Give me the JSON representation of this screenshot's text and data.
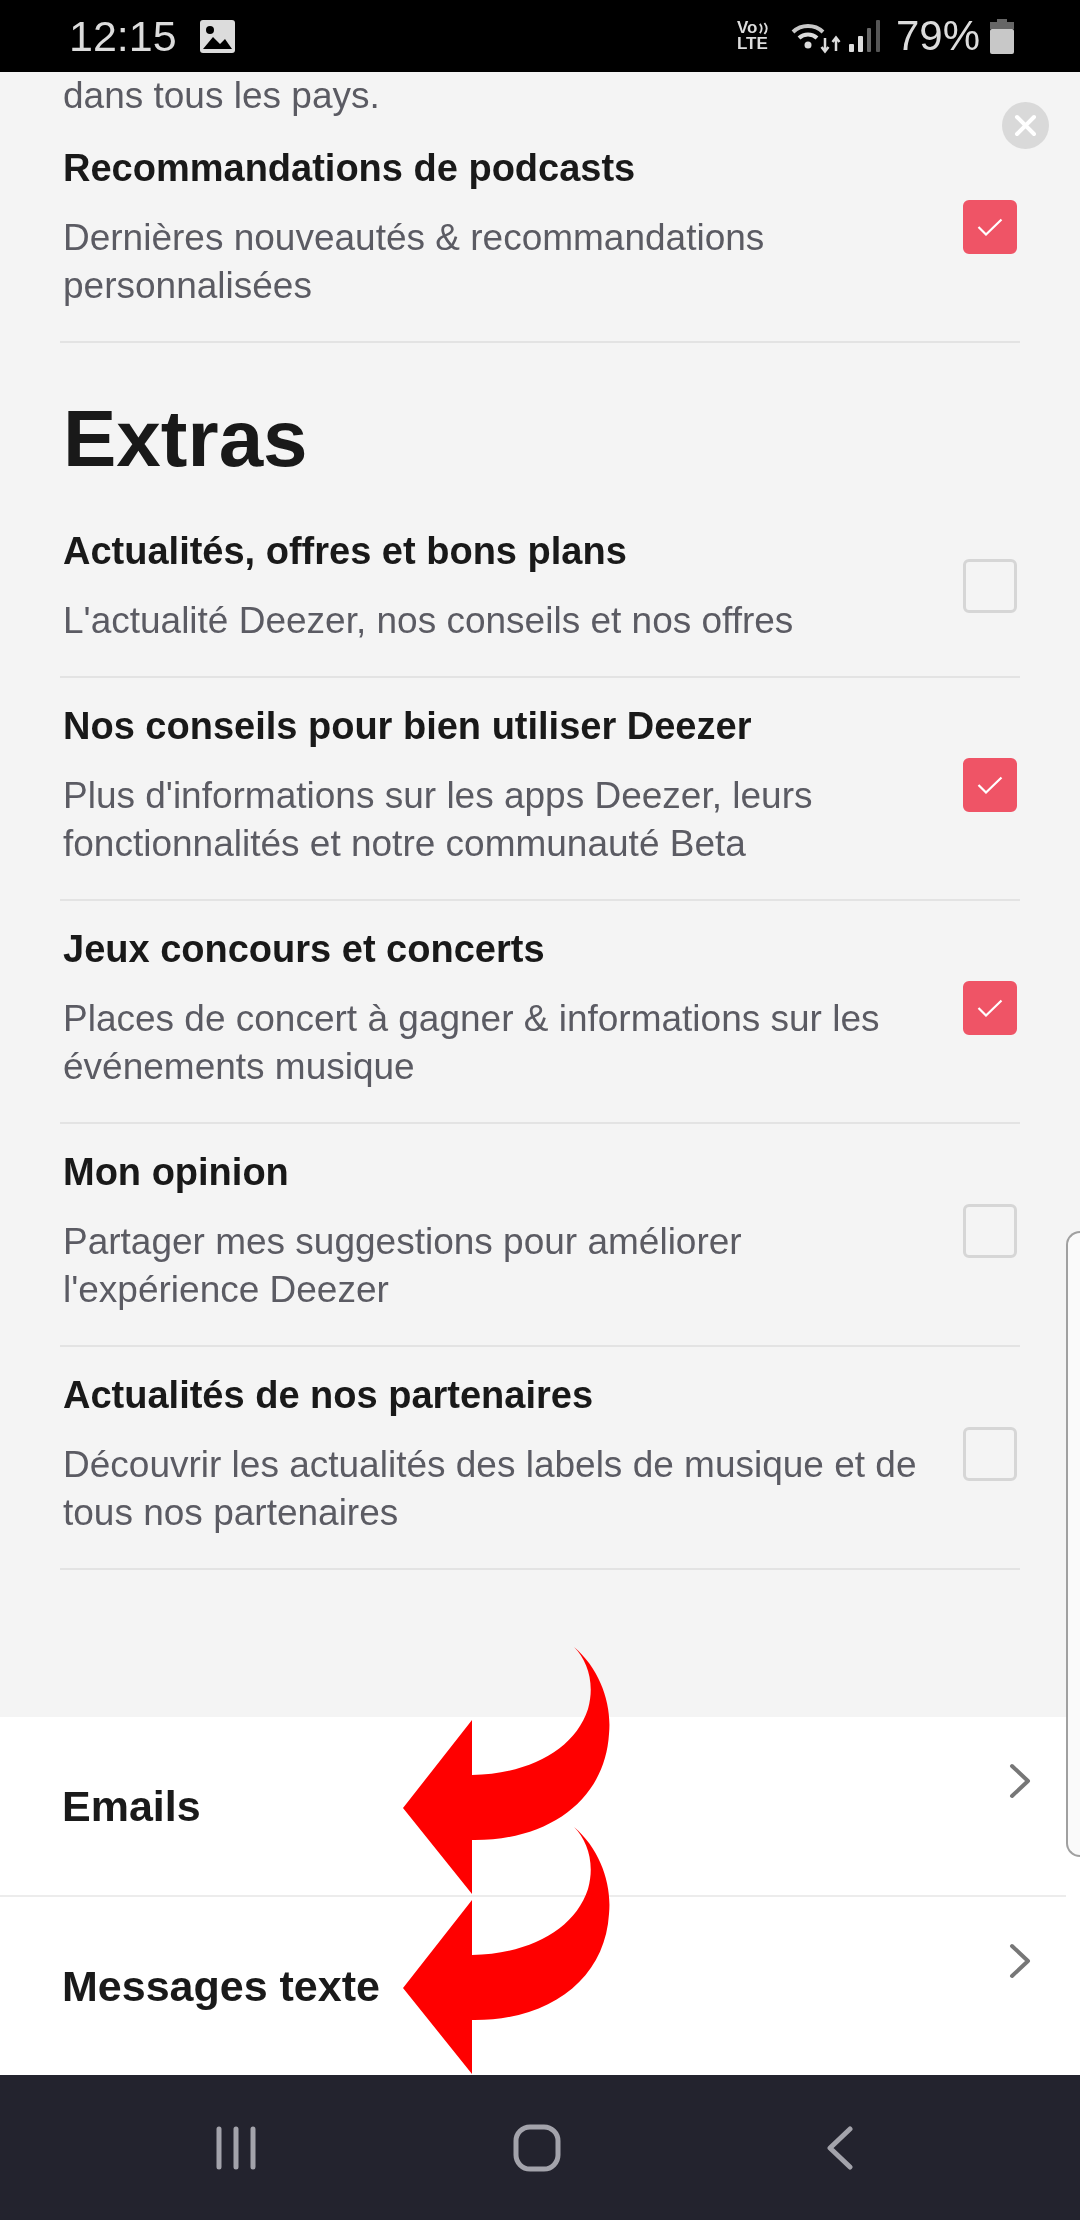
{
  "status_bar": {
    "time": "12:15",
    "volte": {
      "top": "Vo",
      "bottom": "LTE"
    },
    "battery": "79%"
  },
  "partial_text": "dans tous les pays.",
  "top_items": [
    {
      "title": "Recommandations de podcasts",
      "description": "Dernières nouveautés & recommandations\npersonnalisées",
      "checked": true
    }
  ],
  "sections": [
    {
      "heading": "Extras",
      "items": [
        {
          "title": "Actualités, offres et bons plans",
          "description": "L'actualité Deezer, nos conseils et nos offres",
          "checked": false
        },
        {
          "title": "Nos conseils pour bien utiliser Deezer",
          "description": "Plus d'informations sur les apps Deezer, leurs\nfonctionnalités et notre communauté Beta",
          "checked": true
        },
        {
          "title": "Jeux concours et concerts",
          "description": "Places de concert à gagner & informations sur les\névénements musique",
          "checked": true
        },
        {
          "title": "Mon opinion",
          "description": "Partager mes suggestions pour améliorer\nl'expérience Deezer",
          "checked": false
        },
        {
          "title": "Actualités de nos partenaires",
          "description": "Découvrir les actualités des labels de musique et de\ntous nos partenaires",
          "checked": false
        }
      ]
    }
  ],
  "links": [
    {
      "label": "Emails",
      "arrow": true
    },
    {
      "label": "Messages texte",
      "arrow": true
    }
  ]
}
